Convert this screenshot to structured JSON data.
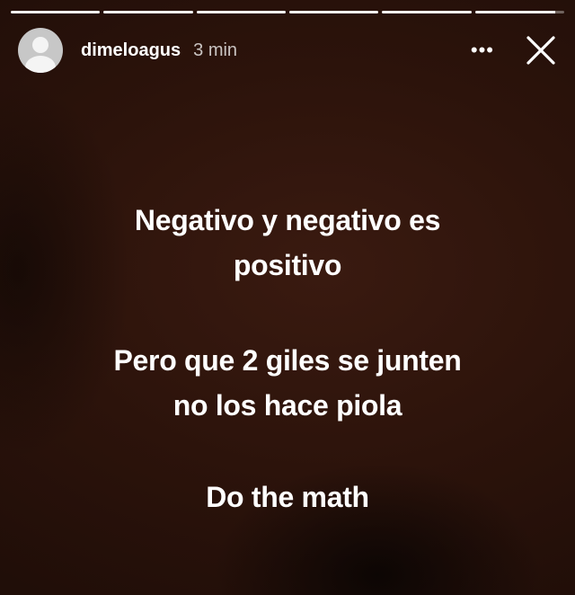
{
  "progress": {
    "segments": [
      1,
      1,
      1,
      1,
      1,
      0.9
    ]
  },
  "header": {
    "username": "dimeloagus",
    "time": "3 min",
    "more_label": "•••",
    "avatar_icon": "default-profile-icon",
    "close_icon": "close-icon"
  },
  "story_text": {
    "paragraph1": {
      "line1": "Negativo y negativo es",
      "line2": "positivo"
    },
    "paragraph2": {
      "line1": "Pero que 2 giles se junten",
      "line2": "no los hace piola"
    },
    "paragraph3": {
      "line1": "Do the math"
    }
  },
  "colors": {
    "background": "#2c130b",
    "text": "#ffffff"
  }
}
